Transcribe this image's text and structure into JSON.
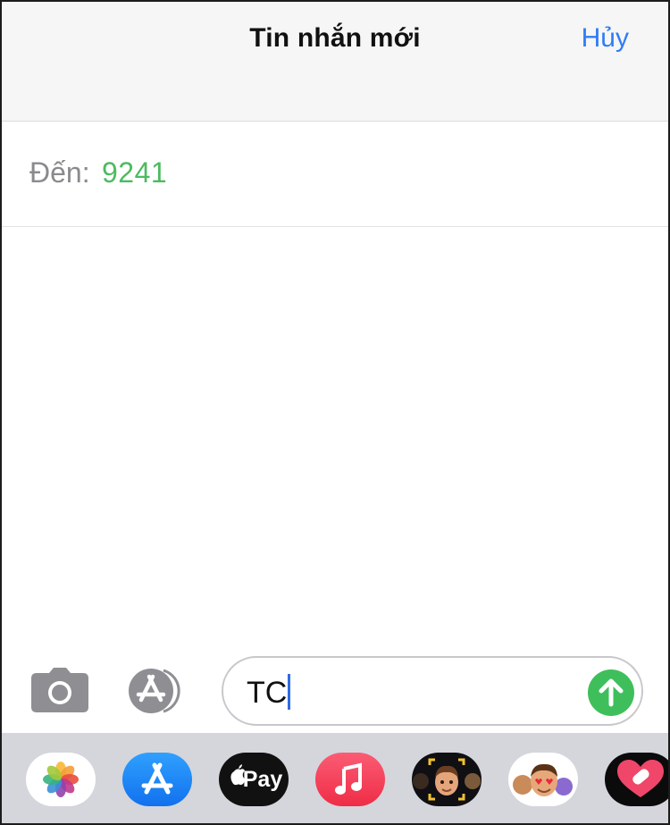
{
  "header": {
    "title": "Tin nhắn mới",
    "cancel_label": "Hủy"
  },
  "recipient": {
    "label": "Đến:",
    "value": "9241"
  },
  "composer": {
    "text": "TC",
    "camera_icon": "camera-icon",
    "appstore_icon": "app-store-icon",
    "send_icon": "arrow-up-icon"
  },
  "app_drawer": {
    "apps": [
      {
        "name": "photos",
        "icon": "photos-icon"
      },
      {
        "name": "app-store",
        "icon": "app-store-icon"
      },
      {
        "name": "apple-pay",
        "icon": "apple-pay-icon",
        "label": "Pay"
      },
      {
        "name": "music",
        "icon": "music-note-icon"
      },
      {
        "name": "memoji",
        "icon": "memoji-icon"
      },
      {
        "name": "memoji-stickers",
        "icon": "memoji-stickers-icon"
      },
      {
        "name": "digital-touch",
        "icon": "heart-icon"
      }
    ]
  },
  "colors": {
    "accent_blue": "#2f7cf6",
    "recipient_green": "#4cbb61",
    "send_green": "#3fbf5b",
    "header_bg": "#f6f6f6",
    "drawer_bg": "#d4d6dc"
  }
}
